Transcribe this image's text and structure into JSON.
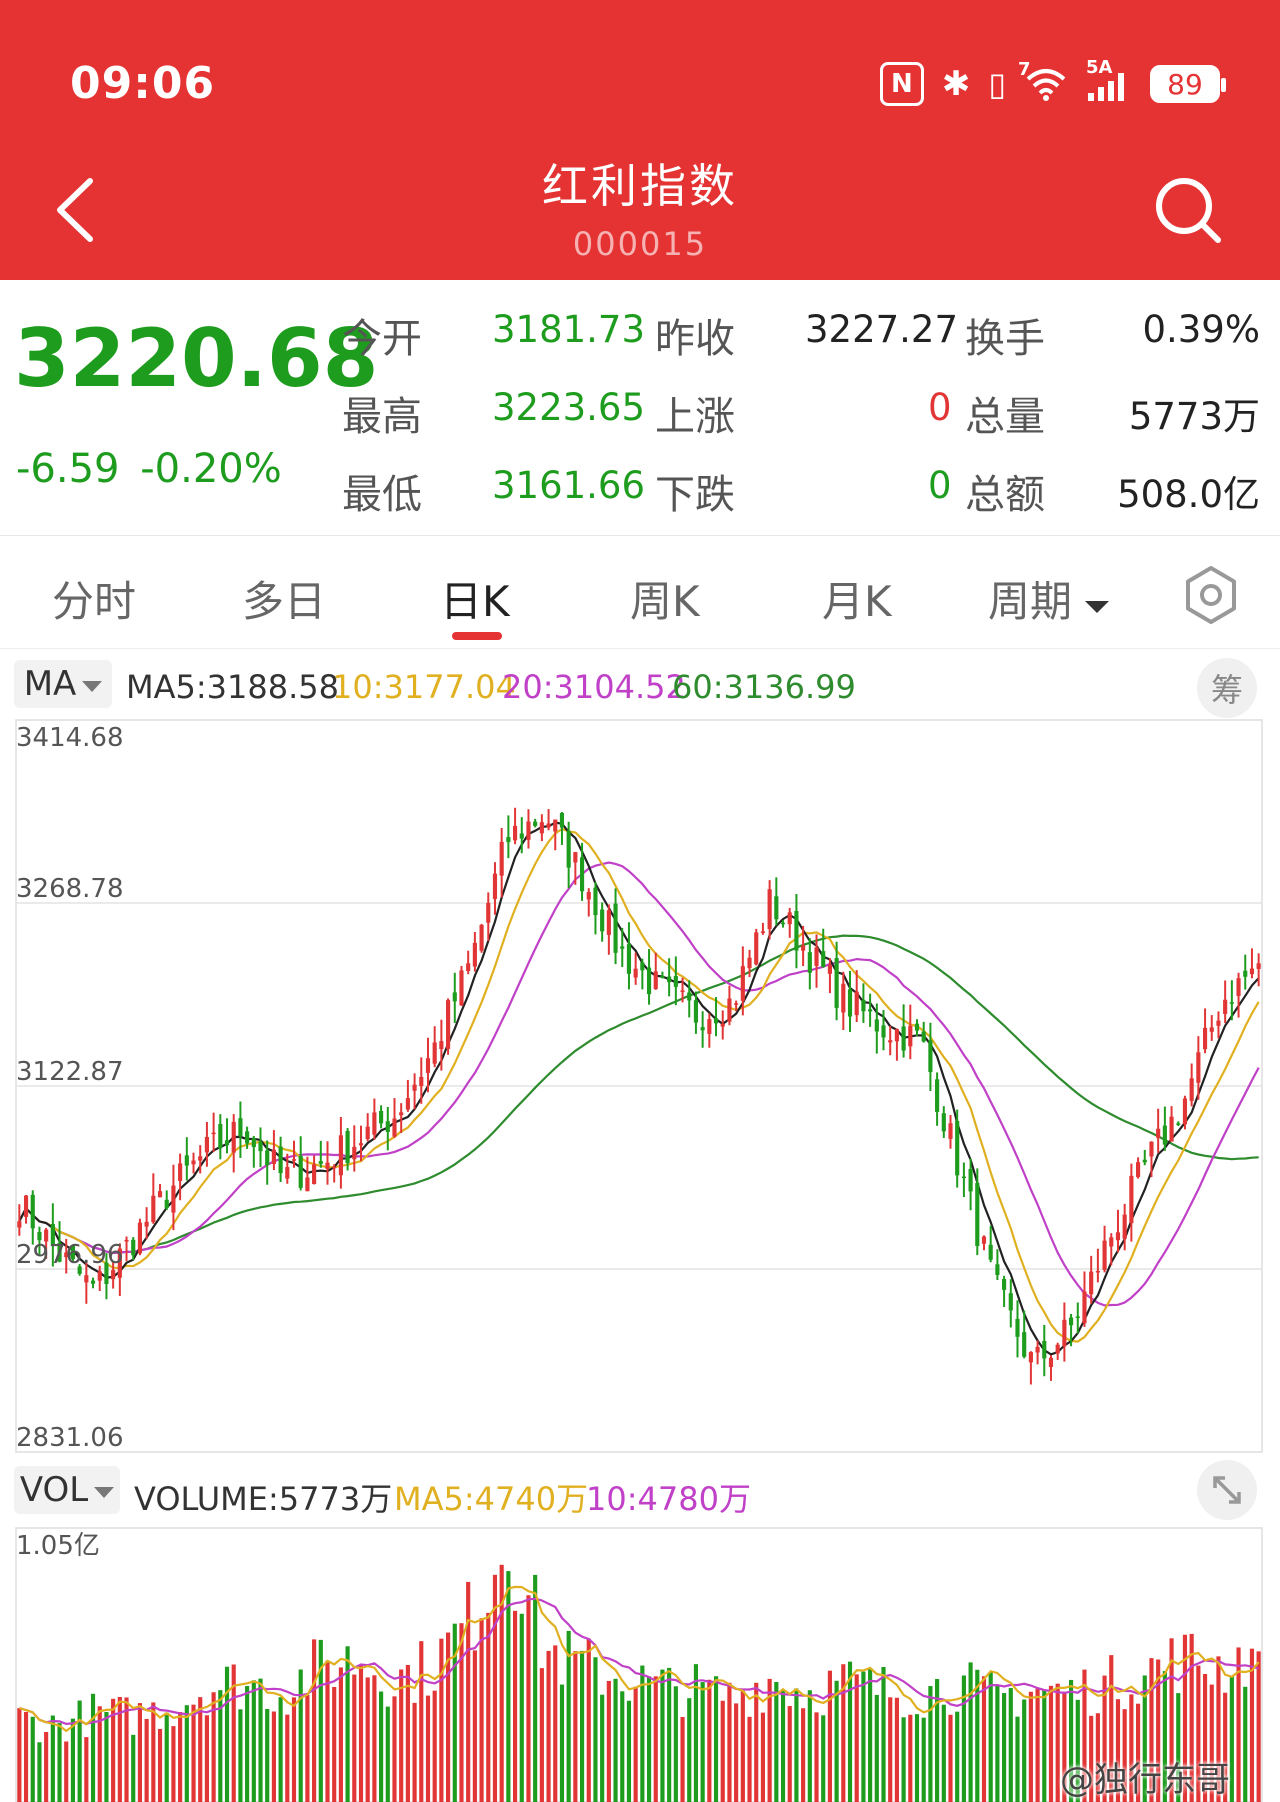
{
  "status_bar": {
    "time": "09:06",
    "network": "5A",
    "wifi_badge": "7",
    "battery": "89"
  },
  "header": {
    "title": "红利指数",
    "code": "000015"
  },
  "quote": {
    "price": "3220.68",
    "change": "-6.59",
    "change_pct": "-0.20%",
    "rows": [
      {
        "l1": "今开",
        "v1": "3181.73",
        "l2": "昨收",
        "v2": "3227.27",
        "l3": "换手",
        "v3": "0.39%"
      },
      {
        "l1": "最高",
        "v1": "3223.65",
        "l2": "上涨",
        "v2": "0",
        "l3": "总量",
        "v3": "5773万"
      },
      {
        "l1": "最低",
        "v1": "3161.66",
        "l2": "下跌",
        "v2": "0",
        "l3": "总额",
        "v3": "508.0亿"
      }
    ]
  },
  "tabs": [
    {
      "label": "分时"
    },
    {
      "label": "多日"
    },
    {
      "label": "日K",
      "active": true
    },
    {
      "label": "周K"
    },
    {
      "label": "月K"
    },
    {
      "label": "周期"
    }
  ],
  "ma_legend": {
    "selector": "MA",
    "ma5": "MA5:3188.58",
    "ma10": "10:3177.04",
    "ma20": "20:3104.52",
    "ma60": "60:3136.99",
    "chip_button": "筹"
  },
  "vol_legend": {
    "selector": "VOL",
    "volume": "VOLUME:5773万",
    "ma5": "MA5:4740万",
    "ma10": "10:4780万"
  },
  "colors": {
    "up": "#e23535",
    "down": "#1e9c1e",
    "ma5": "#222222",
    "ma10": "#e0b020",
    "ma20": "#c040c8",
    "ma60": "#2e8b2e",
    "header": "#e53333"
  },
  "chart_data": [
    {
      "type": "candlestick",
      "title": "",
      "y_ticks": [
        "3414.68",
        "3268.78",
        "3122.87",
        "2976.96",
        "2831.06"
      ],
      "ylim": [
        2831.06,
        3414.68
      ],
      "grid": true,
      "series": [
        {
          "name": "MA5",
          "last": 3188.58
        },
        {
          "name": "10",
          "last": 3177.04
        },
        {
          "name": "20",
          "last": 3104.52
        },
        {
          "name": "60",
          "last": 3136.99
        }
      ],
      "close_anchors": [
        3030,
        2990,
        2960,
        3000,
        3040,
        3070,
        3090,
        3050,
        3060,
        3080,
        3100,
        3150,
        3220,
        3320,
        3340,
        3290,
        3230,
        3200,
        3180,
        3190,
        3270,
        3230,
        3190,
        3170,
        3160,
        3060,
        2960,
        2900,
        2930,
        3000,
        3060,
        3110,
        3190,
        3220
      ],
      "last_close": 3220.68
    },
    {
      "type": "bar",
      "title": "",
      "y_ticks": [
        "1.05亿"
      ],
      "ylim": [
        0,
        1.05
      ],
      "unit": "亿",
      "series": [
        {
          "name": "VOLUME",
          "last": 0.5773
        },
        {
          "name": "MA5",
          "last": 0.474
        },
        {
          "name": "10",
          "last": 0.478
        }
      ],
      "volume_anchors": [
        0.32,
        0.29,
        0.34,
        0.33,
        0.36,
        0.44,
        0.46,
        0.42,
        0.52,
        0.55,
        0.47,
        0.52,
        0.7,
        1.05,
        0.58,
        0.52,
        0.48,
        0.44,
        0.43,
        0.4,
        0.47,
        0.42,
        0.46,
        0.43,
        0.42,
        0.45,
        0.4,
        0.43,
        0.42,
        0.45,
        0.5,
        0.55,
        0.52,
        0.58
      ]
    }
  ],
  "watermark": "@独行东哥"
}
